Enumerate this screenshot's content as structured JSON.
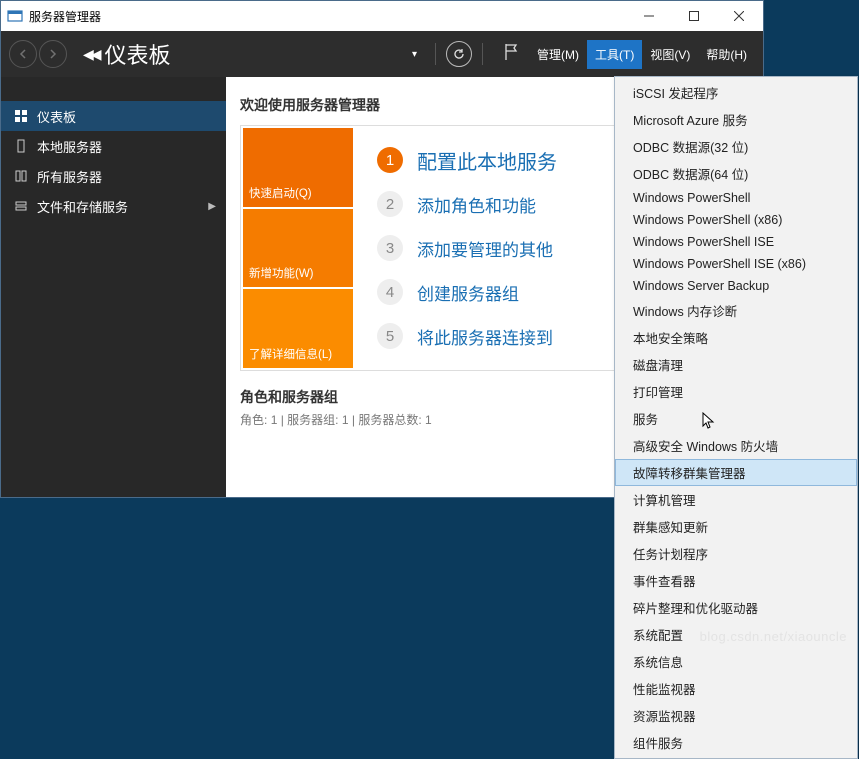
{
  "window": {
    "title": "服务器管理器"
  },
  "topbar": {
    "heading": "仪表板",
    "menus": {
      "manage": "管理(M)",
      "tools": "工具(T)",
      "view": "视图(V)",
      "help": "帮助(H)"
    }
  },
  "sidebar": {
    "items": [
      {
        "label": "仪表板",
        "icon": "dashboard"
      },
      {
        "label": "本地服务器",
        "icon": "server"
      },
      {
        "label": "所有服务器",
        "icon": "servers"
      },
      {
        "label": "文件和存储服务",
        "icon": "storage",
        "expandable": true
      }
    ]
  },
  "main": {
    "welcome": "欢迎使用服务器管理器",
    "orange": {
      "quickstart": "快速启动(Q)",
      "whatsnew": "新增功能(W)",
      "learnmore": "了解详细信息(L)"
    },
    "steps": [
      {
        "n": "1",
        "label": "配置此本地服务"
      },
      {
        "n": "2",
        "label": "添加角色和功能"
      },
      {
        "n": "3",
        "label": "添加要管理的其他"
      },
      {
        "n": "4",
        "label": "创建服务器组"
      },
      {
        "n": "5",
        "label": "将此服务器连接到"
      }
    ],
    "roles": {
      "heading": "角色和服务器组",
      "sub_roles": "角色:",
      "sub_roles_v": "1",
      "sub_groups": "服务器组:",
      "sub_groups_v": "1",
      "sub_total": "服务器总数:",
      "sub_total_v": "1",
      "sep": " | "
    }
  },
  "tools_menu": {
    "items": [
      "iSCSI 发起程序",
      "Microsoft Azure 服务",
      "ODBC 数据源(32 位)",
      "ODBC 数据源(64 位)",
      "Windows PowerShell",
      "Windows PowerShell (x86)",
      "Windows PowerShell ISE",
      "Windows PowerShell ISE (x86)",
      "Windows Server Backup",
      "Windows 内存诊断",
      "本地安全策略",
      "磁盘清理",
      "打印管理",
      "服务",
      "高级安全 Windows 防火墙",
      "故障转移群集管理器",
      "计算机管理",
      "群集感知更新",
      "任务计划程序",
      "事件查看器",
      "碎片整理和优化驱动器",
      "系统配置",
      "系统信息",
      "性能监视器",
      "资源监视器",
      "组件服务"
    ],
    "hover_index": 15
  },
  "watermark": "blog.csdn.net/xiaouncle"
}
